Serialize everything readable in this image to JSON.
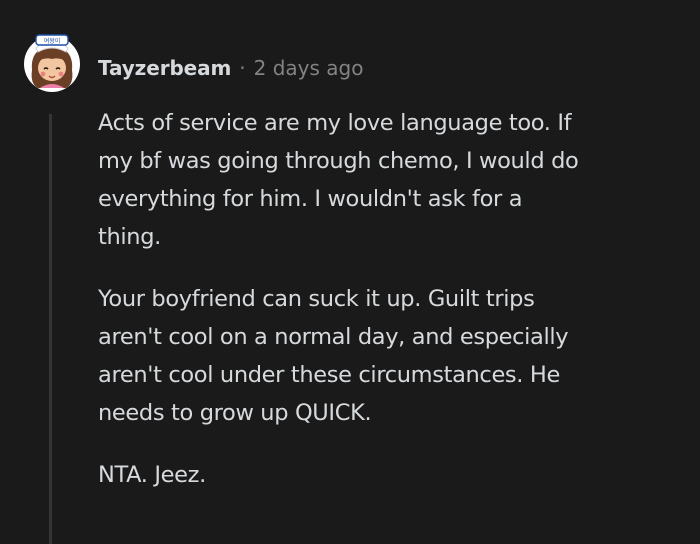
{
  "comment": {
    "author": "Tayzerbeam",
    "separator": "·",
    "timestamp": "2 days ago",
    "avatar": {
      "badge_text": "여왕이",
      "colors": {
        "background": "#ffffff",
        "hair": "#6b3e26",
        "skin": "#f2c6a0",
        "hat_stripe": "#1e4fa8",
        "cheek": "#e9817f"
      }
    },
    "paragraphs": [
      {
        "lines": [
          "Acts of service are my love language too. If",
          "my bf was going through chemo, I would do",
          "everything for him. I wouldn't ask for a",
          "thing."
        ]
      },
      {
        "lines": [
          "Your boyfriend can suck it up. Guilt trips",
          "aren't cool on a normal day, and especially",
          "aren't cool under these circumstances. He",
          "needs to grow up QUICK."
        ]
      },
      {
        "lines": [
          "NTA. Jeez."
        ]
      }
    ]
  },
  "theme": {
    "background": "#1a1a1b",
    "text": "#d7dadc",
    "muted": "#818384",
    "thread_line": "#343536"
  }
}
